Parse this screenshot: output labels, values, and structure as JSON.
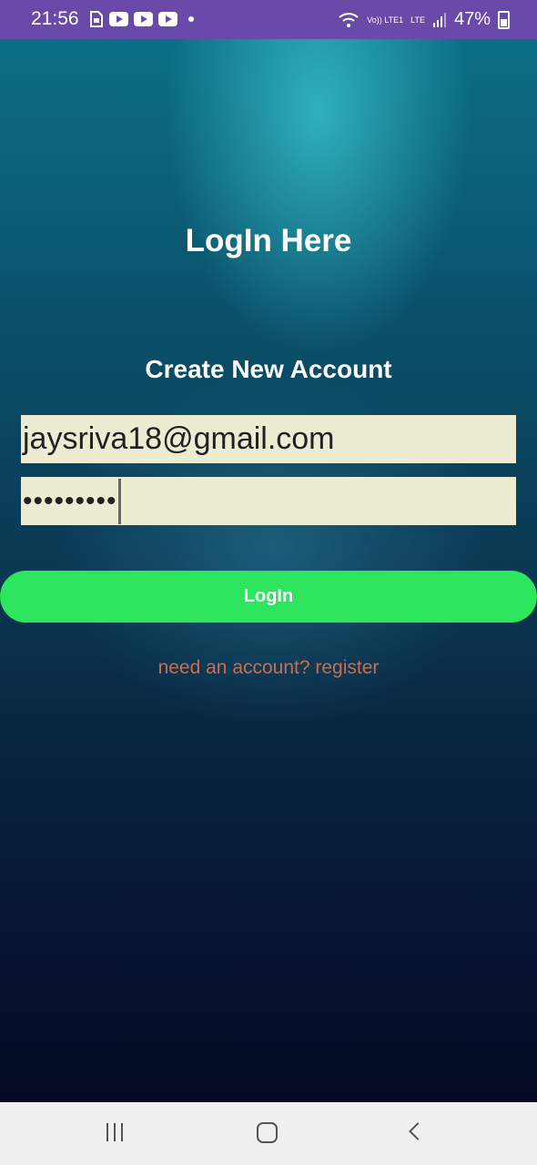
{
  "status_bar": {
    "time": "21:56",
    "volte_label": "Vo)) LTE1",
    "lte_label": "LTE",
    "battery": "47%"
  },
  "screen": {
    "title": "LogIn Here",
    "subtitle": "Create New Account",
    "email_value": "jaysriva18@gmail.com",
    "password_mask": "•••••••••",
    "login_button": "LogIn",
    "register_link": "need an account? register"
  },
  "colors": {
    "status_bar_bg": "#6a4aa8",
    "login_button_bg": "#2ee55e",
    "register_link": "#cf6c4c",
    "field_bg": "#ebecd2"
  },
  "icons": {
    "notifications": [
      "sim-card-icon",
      "youtube-icon",
      "youtube-icon",
      "youtube-icon",
      "dot-icon"
    ],
    "status": [
      "wifi-icon",
      "signal-icon",
      "battery-icon"
    ],
    "navigation": [
      "recent-apps-icon",
      "home-icon",
      "back-icon"
    ]
  }
}
